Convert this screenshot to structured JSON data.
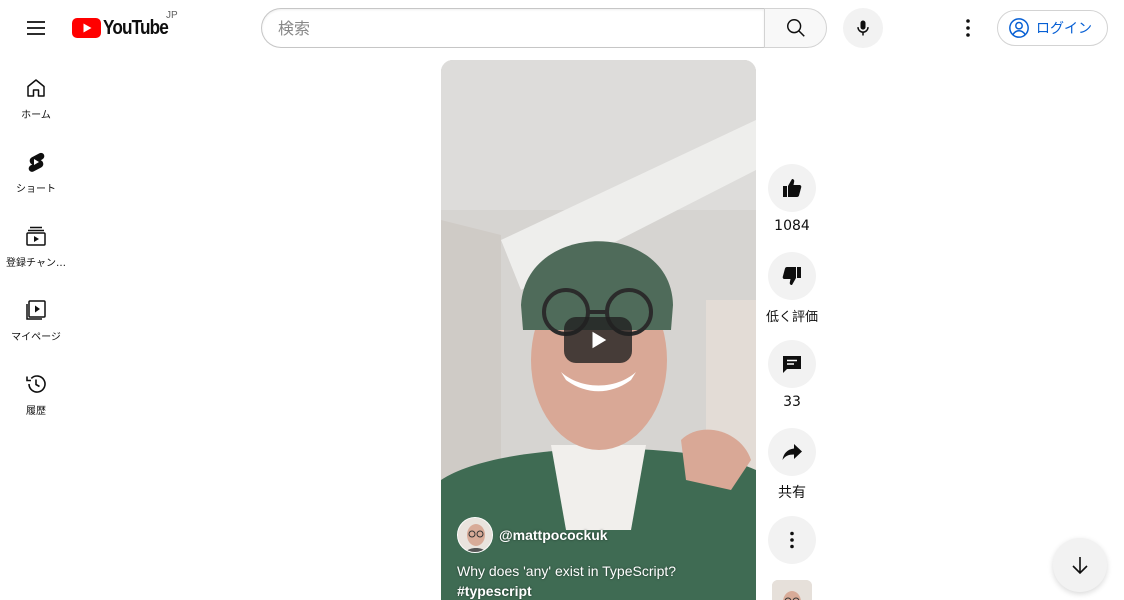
{
  "header": {
    "logo_text": "YouTube",
    "region": "JP",
    "search_placeholder": "検索",
    "login_label": "ログイン"
  },
  "sidebar": {
    "items": [
      {
        "label": "ホーム",
        "icon": "home-icon"
      },
      {
        "label": "ショート",
        "icon": "shorts-icon"
      },
      {
        "label": "登録チャン…",
        "icon": "subscriptions-icon"
      },
      {
        "label": "マイページ",
        "icon": "library-icon"
      },
      {
        "label": "履歴",
        "icon": "history-icon"
      }
    ]
  },
  "video": {
    "channel": "@mattpocockuk",
    "title": "Why does 'any' exist in TypeScript?",
    "hashtag": "#typescript"
  },
  "actions": {
    "like_count": "1084",
    "dislike_label": "低く評価",
    "comment_count": "33",
    "share_label": "共有"
  },
  "colors": {
    "brand_red": "#ff0000",
    "link_blue": "#065fd4",
    "button_bg": "#f2f2f2"
  }
}
